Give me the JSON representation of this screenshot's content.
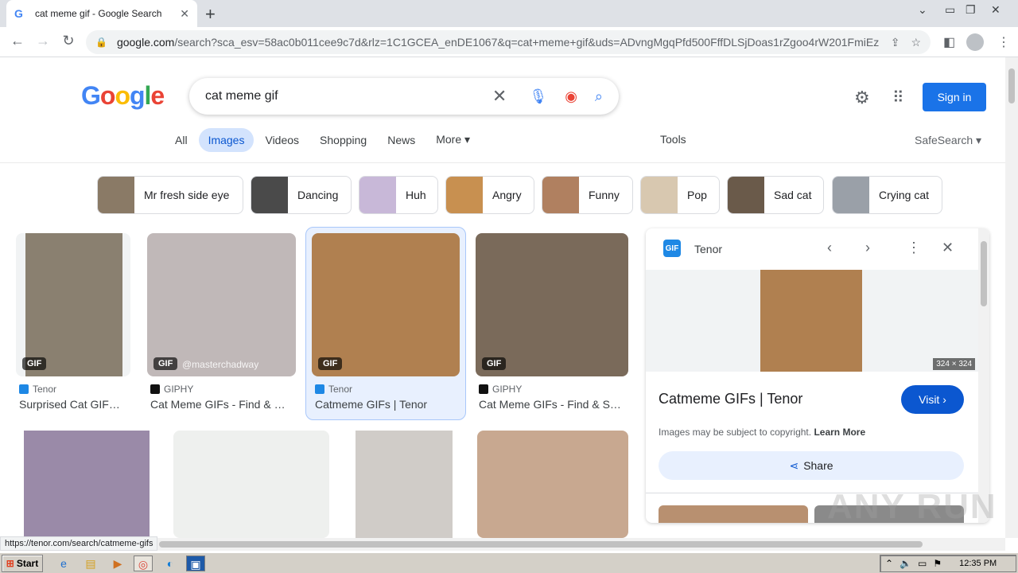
{
  "browser": {
    "tab_title": "cat meme gif - Google Search",
    "tab_close": "✕",
    "new_tab": "+",
    "url_host": "google.com",
    "url_rest": "/search?sca_esv=58ac0b011cee9c7d&rlz=1C1GCEA_enDE1067&q=cat+meme+gif&uds=ADvngMgqPfd500FffDLSjDoas1rZgoo4rW201FmiEz...",
    "status_url": "https://tenor.com/search/catmeme-gifs"
  },
  "google": {
    "logo": [
      "G",
      "o",
      "o",
      "g",
      "l",
      "e"
    ],
    "query": "cat meme gif",
    "sign_in": "Sign in",
    "tabs": [
      {
        "label": "All"
      },
      {
        "label": "Images"
      },
      {
        "label": "Videos"
      },
      {
        "label": "Shopping"
      },
      {
        "label": "News"
      },
      {
        "label": "More ▾"
      }
    ],
    "tools": "Tools",
    "safesearch": "SafeSearch ▾"
  },
  "chips": [
    {
      "label": "Mr fresh side eye",
      "color": "#8a7a66"
    },
    {
      "label": "Dancing",
      "color": "#4a4a4a"
    },
    {
      "label": "Huh",
      "color": "#c8b8d8"
    },
    {
      "label": "Angry",
      "color": "#c89050"
    },
    {
      "label": "Funny",
      "color": "#b08060"
    },
    {
      "label": "Pop",
      "color": "#d8c8b0"
    },
    {
      "label": "Sad cat",
      "color": "#6a5a4a"
    },
    {
      "label": "Crying cat",
      "color": "#9aa0a8"
    }
  ],
  "results": [
    {
      "source": "Tenor",
      "title": "Surprised Cat GIF…",
      "badge": "GIF",
      "fav_color": "#1e88e5",
      "color": "#8a8070"
    },
    {
      "source": "GIPHY",
      "title": "Cat Meme GIFs - Find & …",
      "badge": "GIF",
      "watermark": "@masterchadway",
      "fav_color": "#111111",
      "color": "#c0b8b8"
    },
    {
      "source": "Tenor",
      "title": "Catmeme GIFs | Tenor",
      "badge": "GIF",
      "fav_color": "#1e88e5",
      "color": "#b08050"
    },
    {
      "source": "GIPHY",
      "title": "Cat Meme GIFs - Find & S…",
      "badge": "GIF",
      "fav_color": "#111111",
      "color": "#7a6a5a"
    },
    {
      "color": "#9a8aa8"
    },
    {
      "color": "#eef0ee"
    },
    {
      "color": "#d0ccc8"
    },
    {
      "color": "#c8a890"
    }
  ],
  "panel": {
    "source": "Tenor",
    "favicon": "GIF",
    "dimensions": "324 × 324",
    "title": "Catmeme GIFs | Tenor",
    "visit": "Visit ›",
    "copyright": "Images may be subject to copyright.",
    "learn_more": "Learn More",
    "share": "Share"
  },
  "watermark": "ANY RUN",
  "taskbar": {
    "start": "Start",
    "time": "12:35 PM"
  },
  "colors": {
    "accent": "#1a73e8",
    "chip_border": "#dadce0",
    "selected": "#e8f0fe"
  }
}
